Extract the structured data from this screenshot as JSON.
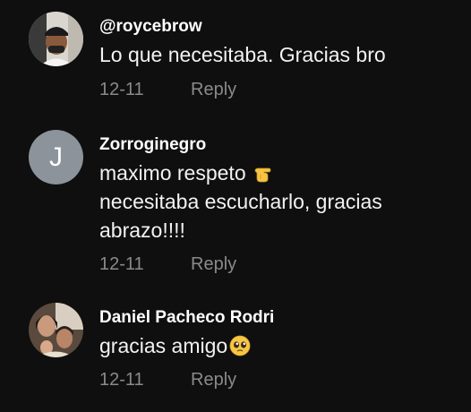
{
  "comments": [
    {
      "username": "@roycebrow",
      "lines": [
        "Lo que necesitaba. Gracias bro"
      ],
      "date": "12-11",
      "reply_label": "Reply",
      "avatar_icon": "profile-photo"
    },
    {
      "username": "Zorroginegro",
      "avatar_initial": "J",
      "avatar_color": "#8c939a",
      "lines": [
        "maximo respeto",
        "necesitaba escucharlo, gracias",
        "abrazo!!!!"
      ],
      "line1_emoji": "pointing-hand-icon",
      "date": "12-11",
      "reply_label": "Reply"
    },
    {
      "username": "Daniel Pacheco Rodri",
      "lines": [
        "gracias amigo"
      ],
      "line1_emoji": "pleading-face-icon",
      "date": "12-11",
      "reply_label": "Reply",
      "avatar_icon": "profile-photo"
    }
  ],
  "colors": {
    "background": "#0f0f0f",
    "text": "#ffffff",
    "meta": "#8a8a8a"
  }
}
